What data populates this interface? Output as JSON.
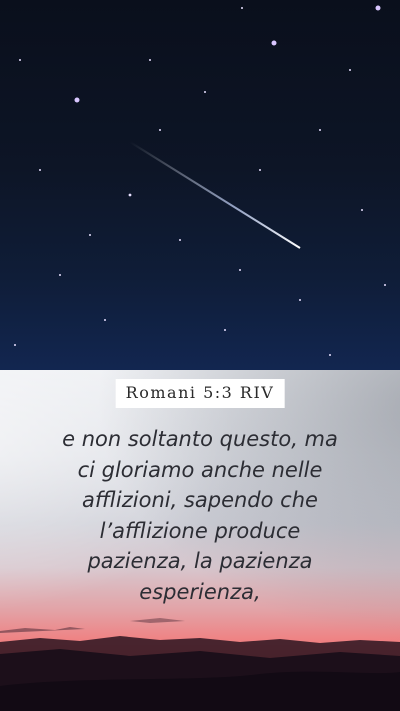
{
  "reference": "Romani 5:3 RIV",
  "verse_lines": [
    "e non soltanto questo, ma",
    "ci gloriamo anche nelle",
    "afflizioni, sapendo che",
    "l’afflizione produce",
    "pazienza, la pazienza",
    "esperienza,"
  ],
  "colors": {
    "night_sky": "#0d1526",
    "sunset_red": "#e55a52",
    "badge_bg": "#ffffff",
    "verse_text": "#2c2d34"
  }
}
